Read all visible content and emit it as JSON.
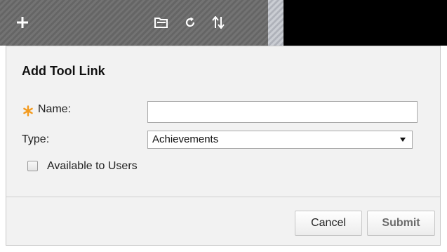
{
  "toolbar": {
    "icons": [
      "plus-icon",
      "folder-icon",
      "refresh-icon",
      "sort-icon"
    ]
  },
  "dialog": {
    "title": "Add Tool Link",
    "name_label": "Name:",
    "name_value": "",
    "type_label": "Type:",
    "type_selected": "Achievements",
    "available_label": "Available to Users",
    "cancel_label": "Cancel",
    "submit_label": "Submit"
  },
  "colors": {
    "toolbar_bg": "#6a6a6a",
    "required_star": "#f39a1d",
    "dialog_bg": "#f2f2f2"
  }
}
